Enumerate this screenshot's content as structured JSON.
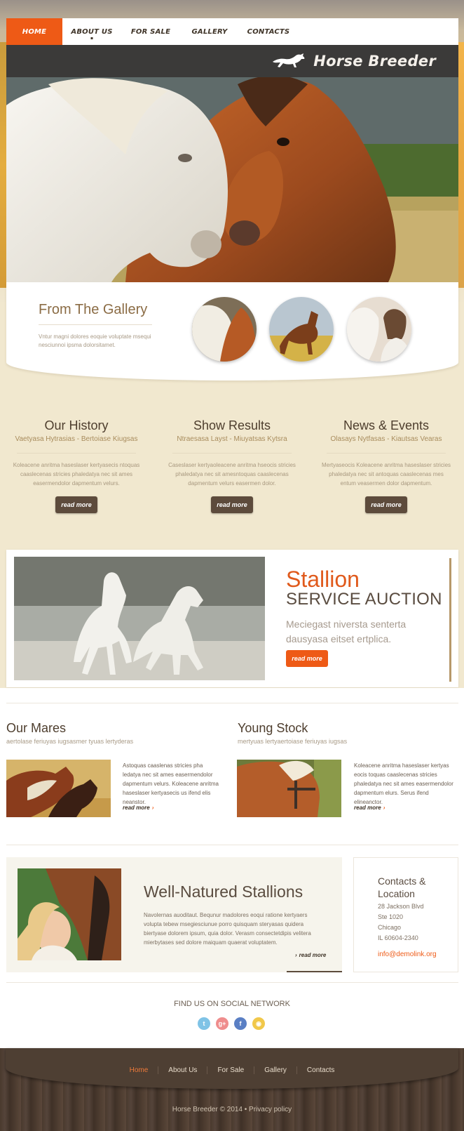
{
  "nav": {
    "items": [
      {
        "label": "HOME",
        "active": true
      },
      {
        "label": "ABOUT US",
        "active": false
      },
      {
        "label": "FOR SALE",
        "active": false
      },
      {
        "label": "GALLERY",
        "active": false
      },
      {
        "label": "CONTACTS",
        "active": false
      }
    ]
  },
  "brand": {
    "title": "Horse Breeder",
    "logo_icon": "running-horse-icon"
  },
  "gallery": {
    "title": "From The Gallery",
    "description": "Vntur magni dolores eoquie voluptate msequi nesciunnoi ipsma dolorsitamet."
  },
  "columns": [
    {
      "title": "Our History",
      "subtitle": "Vaetyasa Hytrasias - Bertoiase Kiugsas",
      "text": "Koleacene anritma haseslaser kertyasecis ntoquas caaslecenas stricies phaledatya nec sit ames easermendolor dapmentum velurs.",
      "button": "read more"
    },
    {
      "title": "Show Results",
      "subtitle": "Ntraesasa Layst - Miuyatsas Kytsra",
      "text": "Caseslaser kertyaoleacene anritma hseocis stricies phaledatya nec sit amesntoquas caaslecenas dapmentum velurs easermen dolor.",
      "button": "read more"
    },
    {
      "title": "News & Events",
      "subtitle": "Olasays Nytfasas - Kiautsas Vearas",
      "text": "Mertyaseocis Koleacene anritma haseslaser stricies phaledatya nec sit antoquas caaslecenas mes entum veasermen dolor dapmentum.",
      "button": "read more"
    }
  ],
  "stallion": {
    "title_line1": "Stallion",
    "title_line2": "SERVICE AUCTION",
    "description": "Meciegast niversta senterta dausyasa eitset ertplica.",
    "button": "read more"
  },
  "mares": {
    "title": "Our Mares",
    "subtitle": "aertolase feriuyas iugsasmer tyuas lertyderas",
    "text": "Astoquas caaslenas stricies pha ledatya nec sit ames easermendolor dapmentum velurs. Koleacene anritma haseslaser kertyasecis us ifend elis neanstor.",
    "more": "read more"
  },
  "young": {
    "title": "Young Stock",
    "subtitle": "mertyuas lertyaertoiase feriuyas iugsas",
    "text": "Koleacene anritma haseslaser kertyas eocis toquas caaslecenas stricies phaledatya nec sit ames easermendolor dapmentum elurs. Serus ifend elineanctor.",
    "more": "read more"
  },
  "well_natured": {
    "title": "Well-Natured Stallions",
    "text": "Navolernas auoditaut. Bequnur madolores eoqui ratione kertyaers volupta tebew msegiesciunue porro quisquam steryasas quidera biertyase dolorem ipsum, quia dolor. Verasm consectetdipis velitera mierbytases sed dolore maiquam quaerat voluptatem.",
    "more": "read more"
  },
  "contacts": {
    "title": "Contacts & Location",
    "lines": [
      "28 Jackson Blvd",
      "Ste 1020",
      "Chicago",
      "IL 60604-2340"
    ],
    "email": "info@demolink.org"
  },
  "social": {
    "title": "FIND US ON SOCIAL NETWORK",
    "icons": [
      {
        "name": "twitter-icon",
        "color": "#7fc3e6"
      },
      {
        "name": "google-plus-icon",
        "color": "#ef8d8d"
      },
      {
        "name": "facebook-icon",
        "color": "#5a7fc4"
      },
      {
        "name": "rss-icon",
        "color": "#f1c84a"
      }
    ]
  },
  "footer": {
    "nav": [
      "Home",
      "About Us",
      "For Sale",
      "Gallery",
      "Contacts"
    ],
    "copyright": "Horse Breeder © 2014 • Privacy policy"
  },
  "colors": {
    "accent": "#ee5a16",
    "dark": "#3b3a39",
    "brown": "#5d4b3c"
  }
}
